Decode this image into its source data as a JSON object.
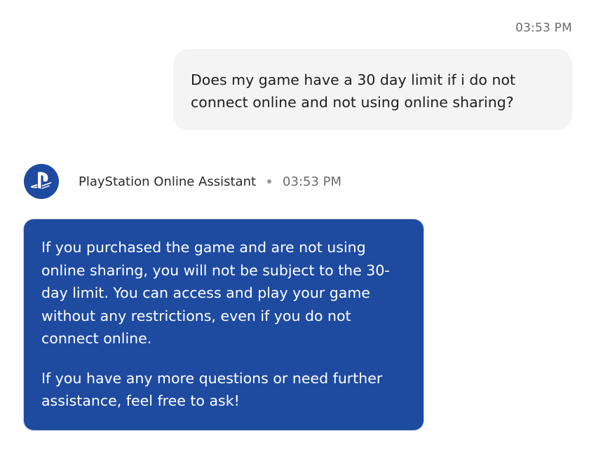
{
  "colors": {
    "background": "#ffffff",
    "user_bubble": "#f4f4f5",
    "agent_bubble": "#1e4ba0",
    "agent_text": "#ffffff",
    "timestamp": "#6b6b6b",
    "avatar_bg": "#1f4aa1"
  },
  "user_message": {
    "timestamp": "03:53 PM",
    "text": "Does my game have a 30 day limit if i do not connect online and not using online sharing?"
  },
  "assistant": {
    "avatar_icon": "playstation-logo-icon",
    "name": "PlayStation Online Assistant",
    "timestamp": "03:53 PM",
    "paragraphs": [
      "If you purchased the game and are not using online sharing, you will not be subject to the 30-day limit. You can access and play your game without any restrictions, even if you do not connect online.",
      "If you have any more questions or need further assistance, feel free to ask!"
    ]
  }
}
